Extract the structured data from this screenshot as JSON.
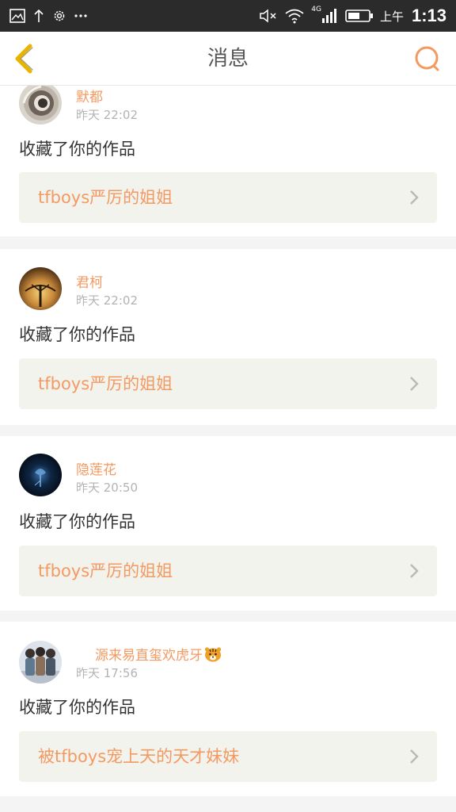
{
  "status_bar": {
    "network_label": "4G",
    "ampm": "上午",
    "time": "1:13"
  },
  "nav": {
    "title": "消息"
  },
  "notifications": [
    {
      "user": "默都",
      "time": "昨天 22:02",
      "action": "收藏了你的作品",
      "work_title": "tfboys严厉的姐姐"
    },
    {
      "user": "君柯",
      "time": "昨天 22:02",
      "action": "收藏了你的作品",
      "work_title": "tfboys严厉的姐姐"
    },
    {
      "user": "隐莲花",
      "time": "昨天 20:50",
      "action": "收藏了你的作品",
      "work_title": "tfboys严厉的姐姐"
    },
    {
      "user": "源来易直玺欢虎牙",
      "time": "昨天 17:56",
      "action": "收藏了你的作品",
      "work_title": "被tfboys宠上天的天才妹妹"
    }
  ],
  "colors": {
    "accent": "#f39a62",
    "back_arrow": "#e8b400",
    "status_bar": "#2b2b2b"
  }
}
